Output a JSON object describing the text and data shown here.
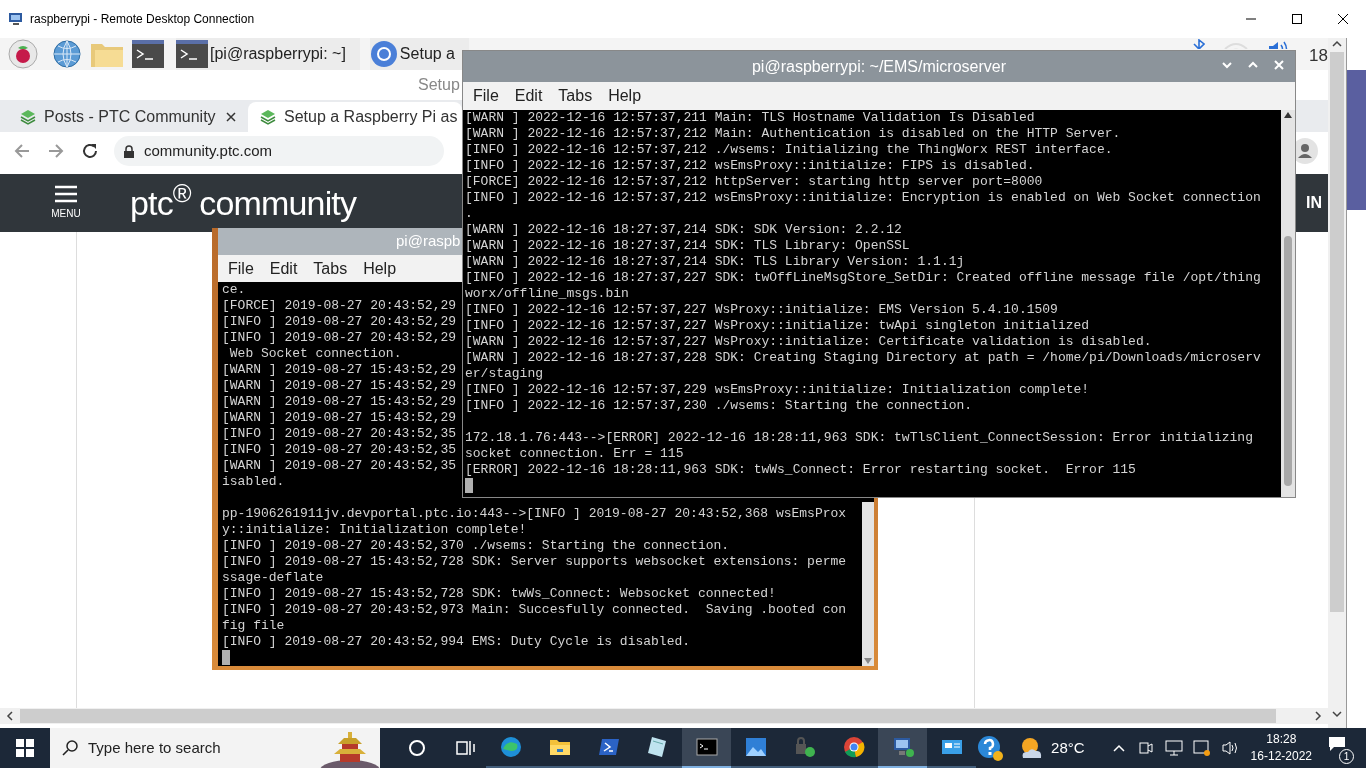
{
  "rdp_window": {
    "title": "raspberrypi - Remote Desktop Connection"
  },
  "pi_panel": {
    "tasks": [
      {
        "kind": "terminal",
        "label": "[pi@raspberrypi: ~]"
      },
      {
        "kind": "browser",
        "label": "Setup a"
      }
    ],
    "clock": "18"
  },
  "browser": {
    "title": "Setup",
    "tabs": [
      {
        "label": "Posts - PTC Community",
        "selected": false
      },
      {
        "label": "Setup a Raspberry Pi as",
        "selected": true
      }
    ],
    "address": "community.ptc.com",
    "site_header": {
      "menu_label": "MENU",
      "logo": "ptc$^{®}$ community",
      "right_text": "IN"
    },
    "embedded_terminal": {
      "title": "pi@raspb",
      "menu": [
        "File",
        "Edit",
        "Tabs",
        "Help"
      ],
      "lines": [
        {
          "text": "ce."
        },
        {
          "text": "[FORCE] 2019-08-27 20:43:52,29"
        },
        {
          "text": "[INFO ] 2019-08-27 20:43:52,29"
        },
        {
          "text": "[INFO ] 2019-08-27 20:43:52,29"
        },
        {
          "text": " Web Socket connection."
        },
        {
          "text": "[WARN ] 2019-08-27 15:43:52,29"
        },
        {
          "text": "[WARN ] 2019-08-27 15:43:52,29"
        },
        {
          "text": "[WARN ] 2019-08-27 15:43:52,29"
        },
        {
          "text": "[WARN ] 2019-08-27 15:43:52,29"
        },
        {
          "text": "[INFO ] 2019-08-27 20:43:52,35"
        },
        {
          "text": "[INFO ] 2019-08-27 20:43:52,35"
        },
        {
          "text": "[WARN ] 2019-08-27 20:43:52,35"
        },
        {
          "text": "isabled."
        },
        {
          "text": "pp-1906261911jv.devportal.ptc.io:443-->[INFO ] 2019-08-27 20:43:52,368 wsEmsProx",
          "blank_before": true
        },
        {
          "text": "y::initialize: Initialization complete!"
        },
        {
          "text": "[INFO ] 2019-08-27 20:43:52,370 ./wsems: Starting the connection."
        },
        {
          "text": "[INFO ] 2019-08-27 15:43:52,728 SDK: Server supports websocket extensions: perme"
        },
        {
          "text": "ssage-deflate"
        },
        {
          "text": "[INFO ] 2019-08-27 15:43:52,728 SDK: twWs_Connect: Websocket connected!"
        },
        {
          "text": "[INFO ] 2019-08-27 20:43:52,973 Main: Succesfully connected.  Saving .booted con"
        },
        {
          "text": "fig file"
        },
        {
          "text": "[INFO ] 2019-08-27 20:43:52,994 EMS: Duty Cycle is disabled."
        }
      ]
    }
  },
  "terminal": {
    "title": "pi@raspberrypi: ~/EMS/microserver",
    "menu": [
      "File",
      "Edit",
      "Tabs",
      "Help"
    ],
    "lines": [
      {
        "text": "[WARN ] 2022-12-16 12:57:37,211 Main: TLS Hostname Validation Is Disabled"
      },
      {
        "text": "[WARN ] 2022-12-16 12:57:37,212 Main: Authentication is disabled on the HTTP Server."
      },
      {
        "text": "[INFO ] 2022-12-16 12:57:37,212 ./wsems: Initializing the ThingWorx REST interface."
      },
      {
        "text": "[INFO ] 2022-12-16 12:57:37,212 wsEmsProxy::initialize: FIPS is disabled."
      },
      {
        "text": "[FORCE] 2022-12-16 12:57:37,212 httpServer: starting http server port=8000"
      },
      {
        "text": "[INFO ] 2022-12-16 12:57:37,212 wsEmsProxy::initialize: Encryption is enabled on Web Socket connection"
      },
      {
        "text": "."
      },
      {
        "text": "[WARN ] 2022-12-16 18:27:37,214 SDK: SDK Version: 2.2.12"
      },
      {
        "text": "[WARN ] 2022-12-16 18:27:37,214 SDK: TLS Library: OpenSSL"
      },
      {
        "text": "[WARN ] 2022-12-16 18:27:37,214 SDK: TLS Library Version: 1.1.1j"
      },
      {
        "text": "[INFO ] 2022-12-16 18:27:37,227 SDK: twOffLineMsgStore_SetDir: Created offline message file /opt/thing"
      },
      {
        "text": "worx/offline_msgs.bin"
      },
      {
        "text": "[INFO ] 2022-12-16 12:57:37,227 WsProxy::initialize: EMS Version 5.4.10.1509"
      },
      {
        "text": "[INFO ] 2022-12-16 12:57:37,227 WsProxy::initialize: twApi singleton initialized"
      },
      {
        "text": "[WARN ] 2022-12-16 12:57:37,227 WsProxy::initialize: Certificate validation is disabled."
      },
      {
        "text": "[WARN ] 2022-12-16 18:27:37,228 SDK: Creating Staging Directory at path = /home/pi/Downloads/microserv"
      },
      {
        "text": "er/staging"
      },
      {
        "text": "[INFO ] 2022-12-16 12:57:37,229 wsEmsProxy::initialize: Initialization complete!"
      },
      {
        "text": "[INFO ] 2022-12-16 12:57:37,230 ./wsems: Starting the connection."
      },
      {
        "text": "172.18.1.76:443-->[ERROR] 2022-12-16 18:28:11,963 SDK: twTlsClient_ConnectSession: Error initializing",
        "blank_before": true
      },
      {
        "text": "socket connection. Err = 115"
      },
      {
        "text": "[ERROR] 2022-12-16 18:28:11,963 SDK: twWs_Connect: Error restarting socket.  Error 115"
      }
    ]
  },
  "taskbar": {
    "search_placeholder": "Type here to search",
    "apps": [
      {
        "kind": "edge",
        "active": false
      },
      {
        "kind": "files",
        "active": false
      },
      {
        "kind": "powershell",
        "active": false
      },
      {
        "kind": "notepad",
        "active": false
      },
      {
        "kind": "cmd",
        "active": true
      },
      {
        "kind": "photos",
        "active": false
      },
      {
        "kind": "lock",
        "active": false
      },
      {
        "kind": "chrome",
        "active": false
      },
      {
        "kind": "rdp",
        "active": true
      },
      {
        "kind": "app",
        "active": false
      }
    ],
    "weather": "28°C",
    "time": "18:28",
    "date": "16-12-2022",
    "notifications": "1"
  }
}
